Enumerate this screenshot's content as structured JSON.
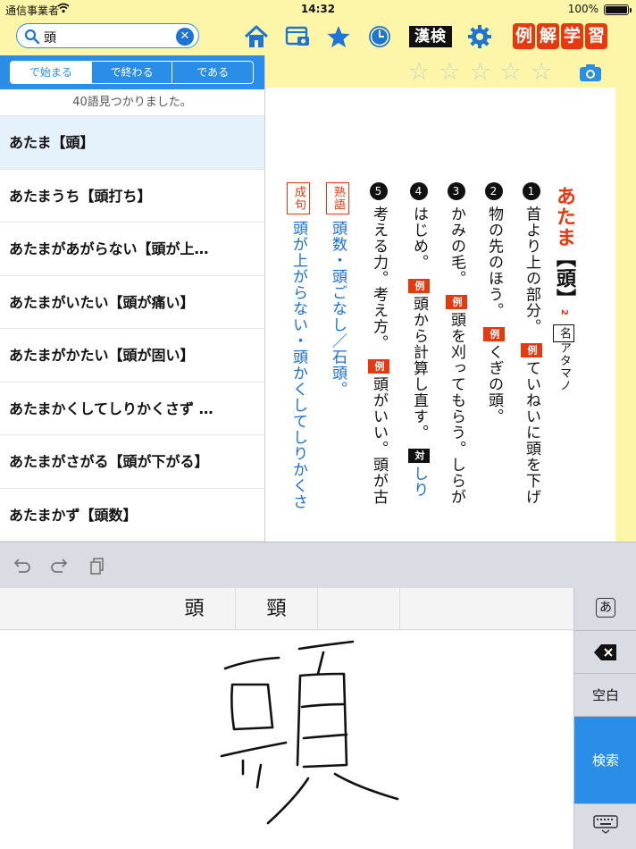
{
  "status_bar": {
    "carrier": "通信事業者",
    "time": "14:32",
    "battery": "100%"
  },
  "search": {
    "value": "頭",
    "clear_icon": "clear-circle-icon"
  },
  "toolbar_icons": [
    "home-icon",
    "window-camera-icon",
    "star-icon",
    "clock-icon",
    "kanken-button",
    "gear-icon"
  ],
  "kanken_label": "漢検",
  "logo_chars": [
    "例",
    "解",
    "学",
    "習"
  ],
  "logo_colors": [
    "#e8380d",
    "#e8380d",
    "#e8380d",
    "#e8380d"
  ],
  "segments": [
    "で始まる",
    "で終わる",
    "である"
  ],
  "result_count": "40語見つかりました。",
  "results": [
    "あたま【頭】",
    "あたまうち【頭打ち】",
    "あたまがあがらない【頭が上…",
    "あたまがいたい【頭が痛い】",
    "あたまがかたい【頭が固い】",
    "あたまかくしてしりかくさず …",
    "あたまがさがる【頭が下がる】",
    "あたまかず【頭数】"
  ],
  "dictionary": {
    "headword": "あたま",
    "headword_kanji": "【頭】",
    "grade": "2",
    "pos": "名",
    "accent": "アタマノ",
    "senses": [
      {
        "num": "1",
        "text": "首より上の部分。",
        "example": "ていねいに頭を下げ"
      },
      {
        "num": "2",
        "text": "物の先のほう。",
        "example": "くぎの頭。"
      },
      {
        "num": "3",
        "text": "かみの毛。",
        "example": "頭を刈ってもらう。しらが"
      },
      {
        "num": "4",
        "text": "はじめ。",
        "example": "頭から計算し直す。",
        "tsui": "対",
        "tsui_text": "しり"
      },
      {
        "num": "5",
        "text": "考える力。考え方。",
        "example": "頭がいい。頭が古"
      }
    ],
    "jukugo_label": "熟語",
    "jukugo": "頭数・頭ごなし／石頭。",
    "seiku_label": "成句",
    "seiku": "頭が上がらない・頭かくしてしりかくさ"
  },
  "keyboard": {
    "candidates": [
      "頭",
      "頸"
    ],
    "kana_key": "あ",
    "space_key": "空白",
    "search_key": "検索"
  }
}
